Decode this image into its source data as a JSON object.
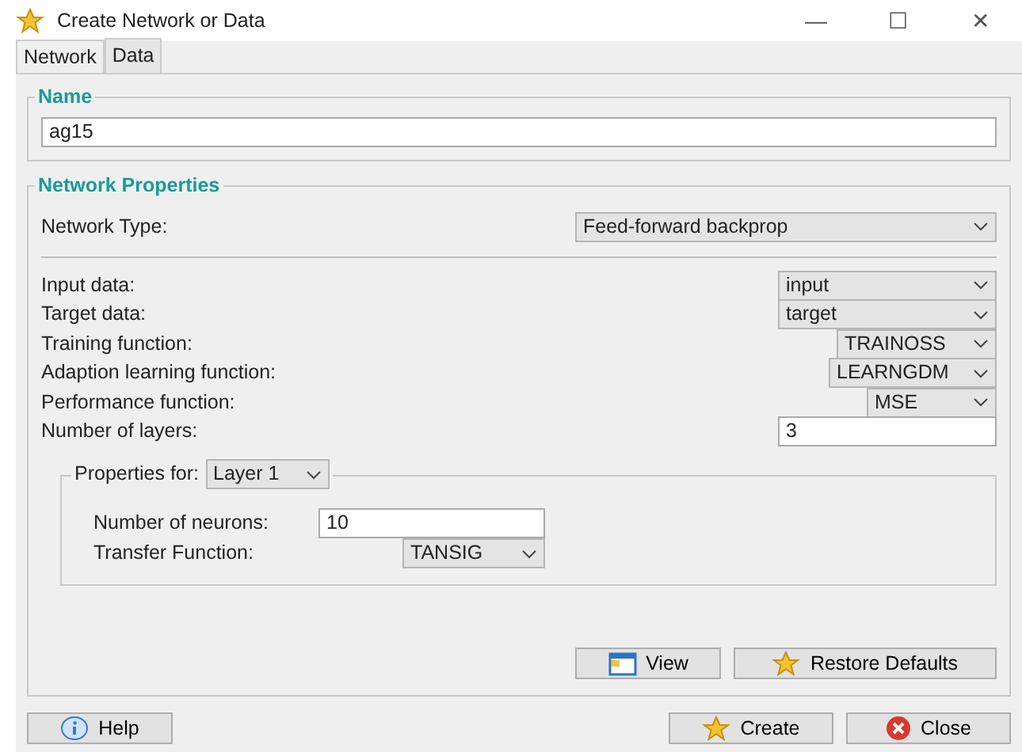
{
  "window": {
    "title": "Create Network or Data",
    "controls": [
      "—",
      "☐",
      "✕"
    ]
  },
  "tabs": [
    {
      "label": "Network",
      "selected": true
    },
    {
      "label": "Data",
      "selected": false
    }
  ],
  "name_section": {
    "legend": "Name",
    "value": "ag15"
  },
  "properties": {
    "legend": "Network Properties",
    "network_type": {
      "label": "Network Type:",
      "value": "Feed-forward backprop"
    },
    "rows": [
      {
        "label": "Input data:",
        "kind": "combo",
        "value": "input"
      },
      {
        "label": "Target data:",
        "kind": "combo",
        "value": "target"
      },
      {
        "label": "Training function:",
        "kind": "combo",
        "value": "TRAINOSS"
      },
      {
        "label": "Adaption learning function:",
        "kind": "combo",
        "value": "LEARNGDM"
      },
      {
        "label": "Performance function:",
        "kind": "combo",
        "value": "MSE"
      },
      {
        "label": "Number of layers:",
        "kind": "text",
        "value": "3"
      }
    ],
    "layer_properties": {
      "label": "Properties for:",
      "layer": "Layer 1",
      "fields": [
        {
          "label": "Number of neurons:",
          "kind": "text",
          "value": "10"
        },
        {
          "label": "Transfer Function:",
          "kind": "combo",
          "value": "TANSIG"
        }
      ]
    },
    "buttons": [
      {
        "label": "View",
        "kind": "window"
      },
      {
        "label": "Restore Defaults",
        "kind": "star"
      }
    ]
  },
  "footer_buttons": [
    {
      "label": "Help",
      "kind": "info"
    },
    {
      "label": "Create",
      "kind": "star"
    },
    {
      "label": "Close",
      "kind": "close"
    }
  ]
}
